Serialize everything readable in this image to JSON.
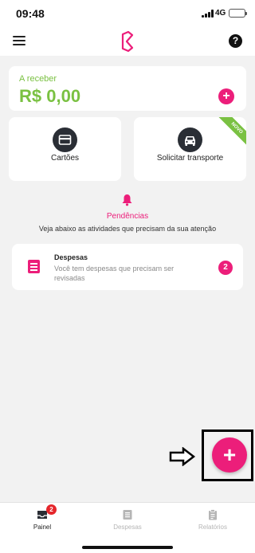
{
  "status_bar": {
    "time": "09:48",
    "network": "4G",
    "battery_color": "#f5c400"
  },
  "top_nav": {
    "menu_icon": "hamburger-menu-icon",
    "logo_icon": "brand-logo-icon",
    "help_icon": "help-icon",
    "help_glyph": "?"
  },
  "balance": {
    "label": "A receber",
    "value": "R$ 0,00",
    "add_glyph": "+"
  },
  "shortcuts": [
    {
      "label": "Cartões",
      "icon": "credit-card-icon"
    },
    {
      "label": "Solicitar transporte",
      "icon": "car-icon",
      "ribbon": "NOVO"
    }
  ],
  "pending": {
    "icon": "bell-icon",
    "title": "Pendências",
    "subtitle": "Veja abaixo as atividades que precisam da sua atenção"
  },
  "expense_card": {
    "icon": "document-icon",
    "title": "Despesas",
    "description": "Você tem despesas que precisam ser revisadas",
    "count": "2"
  },
  "fab": {
    "glyph": "+"
  },
  "bottom_nav": {
    "items": [
      {
        "label": "Painel",
        "icon": "inbox-icon",
        "badge": "2",
        "active": true
      },
      {
        "label": "Despesas",
        "icon": "document-icon",
        "active": false
      },
      {
        "label": "Relatórios",
        "icon": "clipboard-icon",
        "active": false
      }
    ]
  },
  "colors": {
    "accent": "#ec1e7a",
    "balance_green": "#7ac142",
    "background": "#f2f2f2",
    "tile_icon_dark": "#2a2e35"
  }
}
